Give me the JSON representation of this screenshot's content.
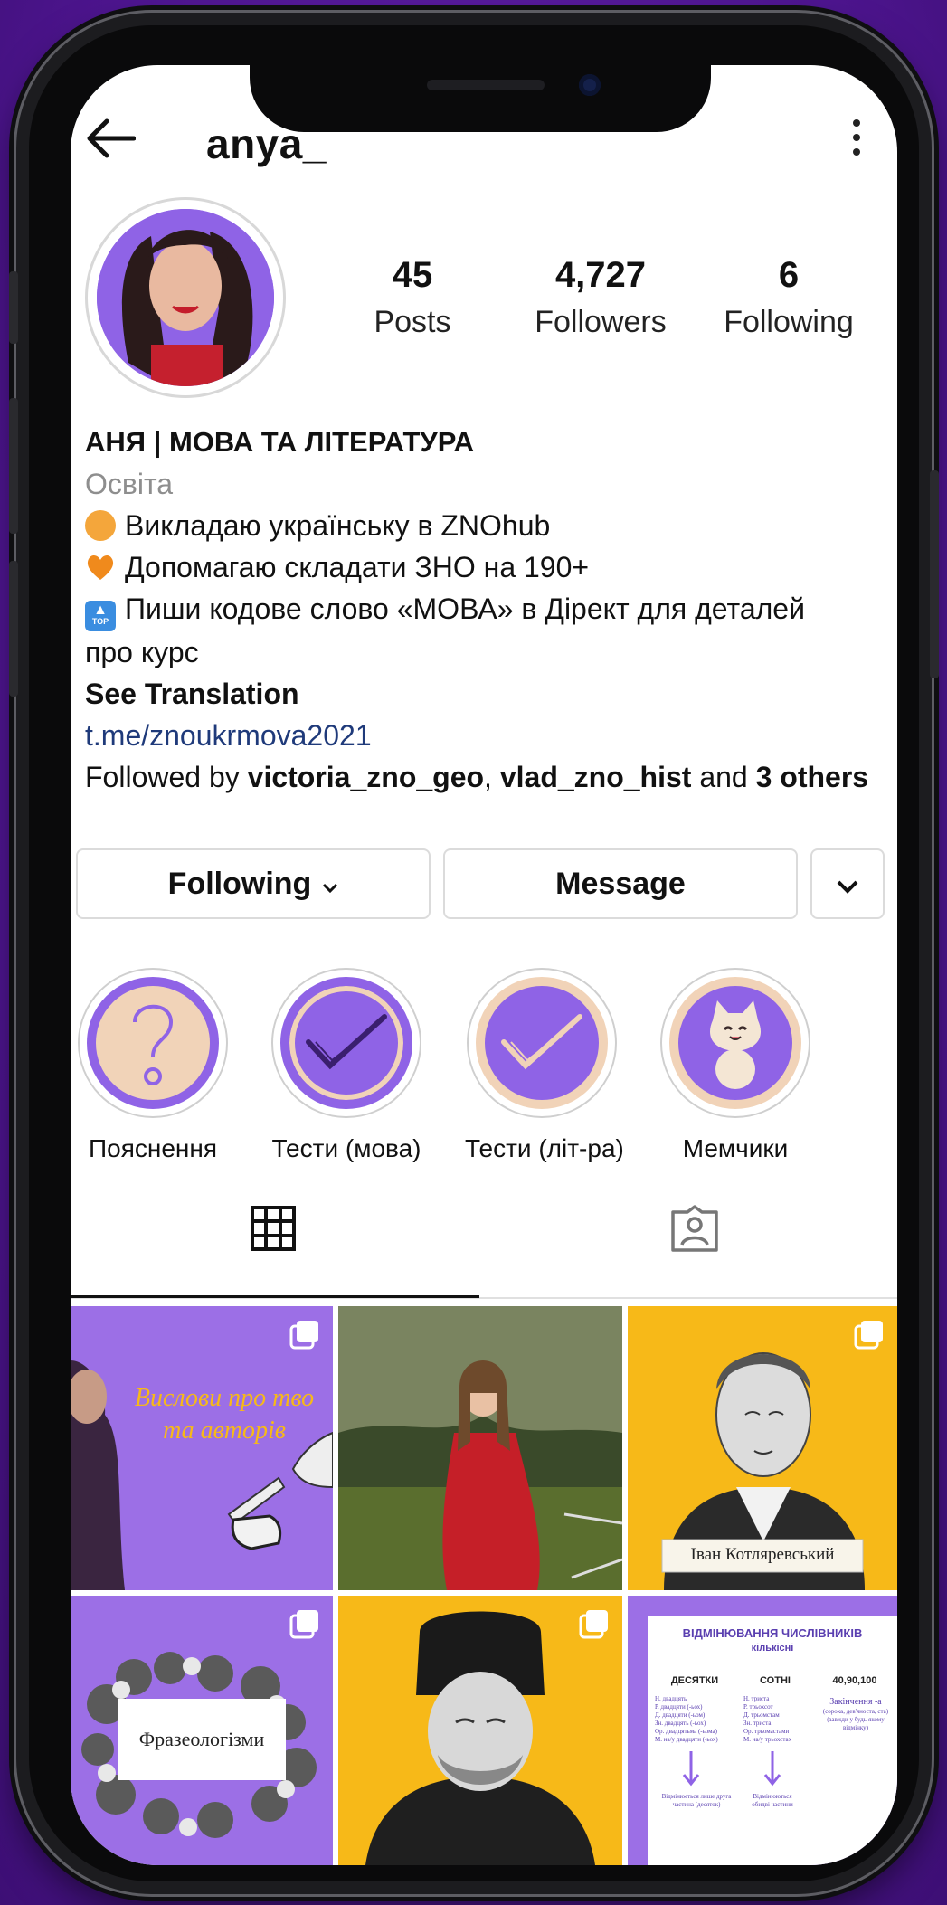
{
  "header": {
    "username": "anya_",
    "back_icon": "back-arrow-icon",
    "more_icon": "more-vertical-icon"
  },
  "stats": [
    {
      "value": "45",
      "label": "Posts"
    },
    {
      "value": "4,727",
      "label": "Followers"
    },
    {
      "value": "6",
      "label": "Following"
    }
  ],
  "bio": {
    "name": "АНЯ | МОВА ТА ЛІТЕРАТУРА",
    "category": "Освіта",
    "lines": [
      "Викладаю українську в ZNOhub",
      "Допомагаю складати ЗНО на 190+",
      "Пиши кодове слово «МОВА» в Дірект для деталей",
      "про курс"
    ],
    "top_badge": "TOP",
    "see_translation": "See Translation",
    "link": "t.me/znoukrmova2021",
    "followed_by_prefix": "Followed by ",
    "followed_user_1": "victoria_zno_geo",
    "followed_sep": ", ",
    "followed_user_2": "vlad_zno_hist",
    "followed_and": " and ",
    "followed_others": "3 others"
  },
  "buttons": {
    "following": "Following",
    "message": "Message"
  },
  "highlights": [
    {
      "label": "Пояснення",
      "icon": "question-mark-icon"
    },
    {
      "label": "Тести (мова)",
      "icon": "checkmark-icon"
    },
    {
      "label": "Тести (літ-ра)",
      "icon": "checkmark-icon"
    },
    {
      "label": "Мемчики",
      "icon": "cat-icon"
    }
  ],
  "tabs": [
    {
      "icon": "grid-icon"
    },
    {
      "icon": "tagged-icon"
    }
  ],
  "posts": {
    "p1_text": "Вислови про тво\nта авторів",
    "p3_caption": "Іван Котляревський",
    "p4_text": "Фразеологізми",
    "p6": {
      "title": "ВІДМІНЮВАННЯ ЧИСЛІВНИКІВ",
      "subtitle": "кількісні",
      "col1": "ДЕСЯТКИ",
      "col2": "СОТНІ",
      "col3": "40,90,100",
      "col1_rows": [
        "Н. двадцять",
        "Р. двадцяти (-ьох)",
        "Д. двадцяти (-ьом)",
        "Зн. двадцять (-ьох)",
        "Ор. двадцятьма (-ьома)",
        "М. на/у двадцяти (-ьох)"
      ],
      "col2_rows": [
        "Н. триста",
        "Р. трьохсот",
        "Д. трьомстам",
        "Зн. триста",
        "Ор. трьомастами",
        "М. на/у трьохстах"
      ],
      "col3_rows": [
        "Закінчення -а",
        "(сорока, дев'яноста, ста)",
        "(завжди у будь-якому відмінку)"
      ],
      "note1": "Відмінюється лише друга частина (десяток)",
      "note2": "Відмінюються обидві частини"
    }
  },
  "colors": {
    "accent": "#8f63e6",
    "yellow": "#f7b918",
    "peach": "#f1d3b8",
    "link": "#1f3a7a"
  }
}
